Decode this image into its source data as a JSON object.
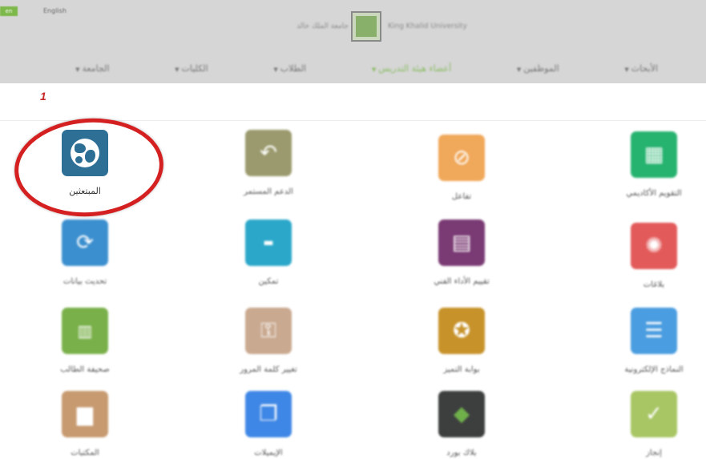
{
  "header": {
    "corner_tag": "en",
    "lang_link": "English",
    "brand_ar": "جامعة الملك خالد",
    "brand_en": "King Khalid University",
    "nav": [
      {
        "label": "الجامعة",
        "active": false
      },
      {
        "label": "الكليات",
        "active": false
      },
      {
        "label": "الطلاب",
        "active": false
      },
      {
        "label": "أعضاء هيئة التدريس",
        "active": true
      },
      {
        "label": "الموظفين",
        "active": false
      },
      {
        "label": "الأبحاث",
        "active": false
      }
    ]
  },
  "step_marker": "1",
  "tiles": [
    {
      "label": "المبتعثين",
      "icon": "globe-icon",
      "color": "#2e6f96"
    },
    {
      "label": "الدعم المستمر",
      "icon": "reply-arrow-icon",
      "color": "#9b9a6e"
    },
    {
      "label": "تفاعل",
      "icon": "orbit-icon",
      "color": "#f0a85a"
    },
    {
      "label": "التقويم الأكاديمي",
      "icon": "calendar-icon",
      "color": "#26b36f"
    },
    {
      "label": "تحديث بيانات",
      "icon": "sync-icon",
      "color": "#3b8fcf"
    },
    {
      "label": "تمكين",
      "icon": "tamkeen-icon",
      "color": "#2aa7c9"
    },
    {
      "label": "تقييم الأداء الفني",
      "icon": "clipboard-icon",
      "color": "#7a3a73"
    },
    {
      "label": "بلاغات",
      "icon": "alarm-icon",
      "color": "#e35a5a"
    },
    {
      "label": "صحيفة الطالب",
      "icon": "newspaper-icon",
      "color": "#7ab04a"
    },
    {
      "label": "تغيير كلمة المرور",
      "icon": "key-icon",
      "color": "#c9a990"
    },
    {
      "label": "بوابة التميز",
      "icon": "award-icon",
      "color": "#c7922a"
    },
    {
      "label": "النماذج الإلكترونية",
      "icon": "forms-icon",
      "color": "#4a9de0"
    },
    {
      "label": "المكتبات",
      "icon": "library-icon",
      "color": "#c79a70"
    },
    {
      "label": "الإيميلات",
      "icon": "documents-icon",
      "color": "#3f87e6"
    },
    {
      "label": "بلاك بورد",
      "icon": "blackboard-icon",
      "color": "#3d3f3f"
    },
    {
      "label": "إنجاز",
      "icon": "checkmark-icon",
      "color": "#a8c664"
    }
  ]
}
